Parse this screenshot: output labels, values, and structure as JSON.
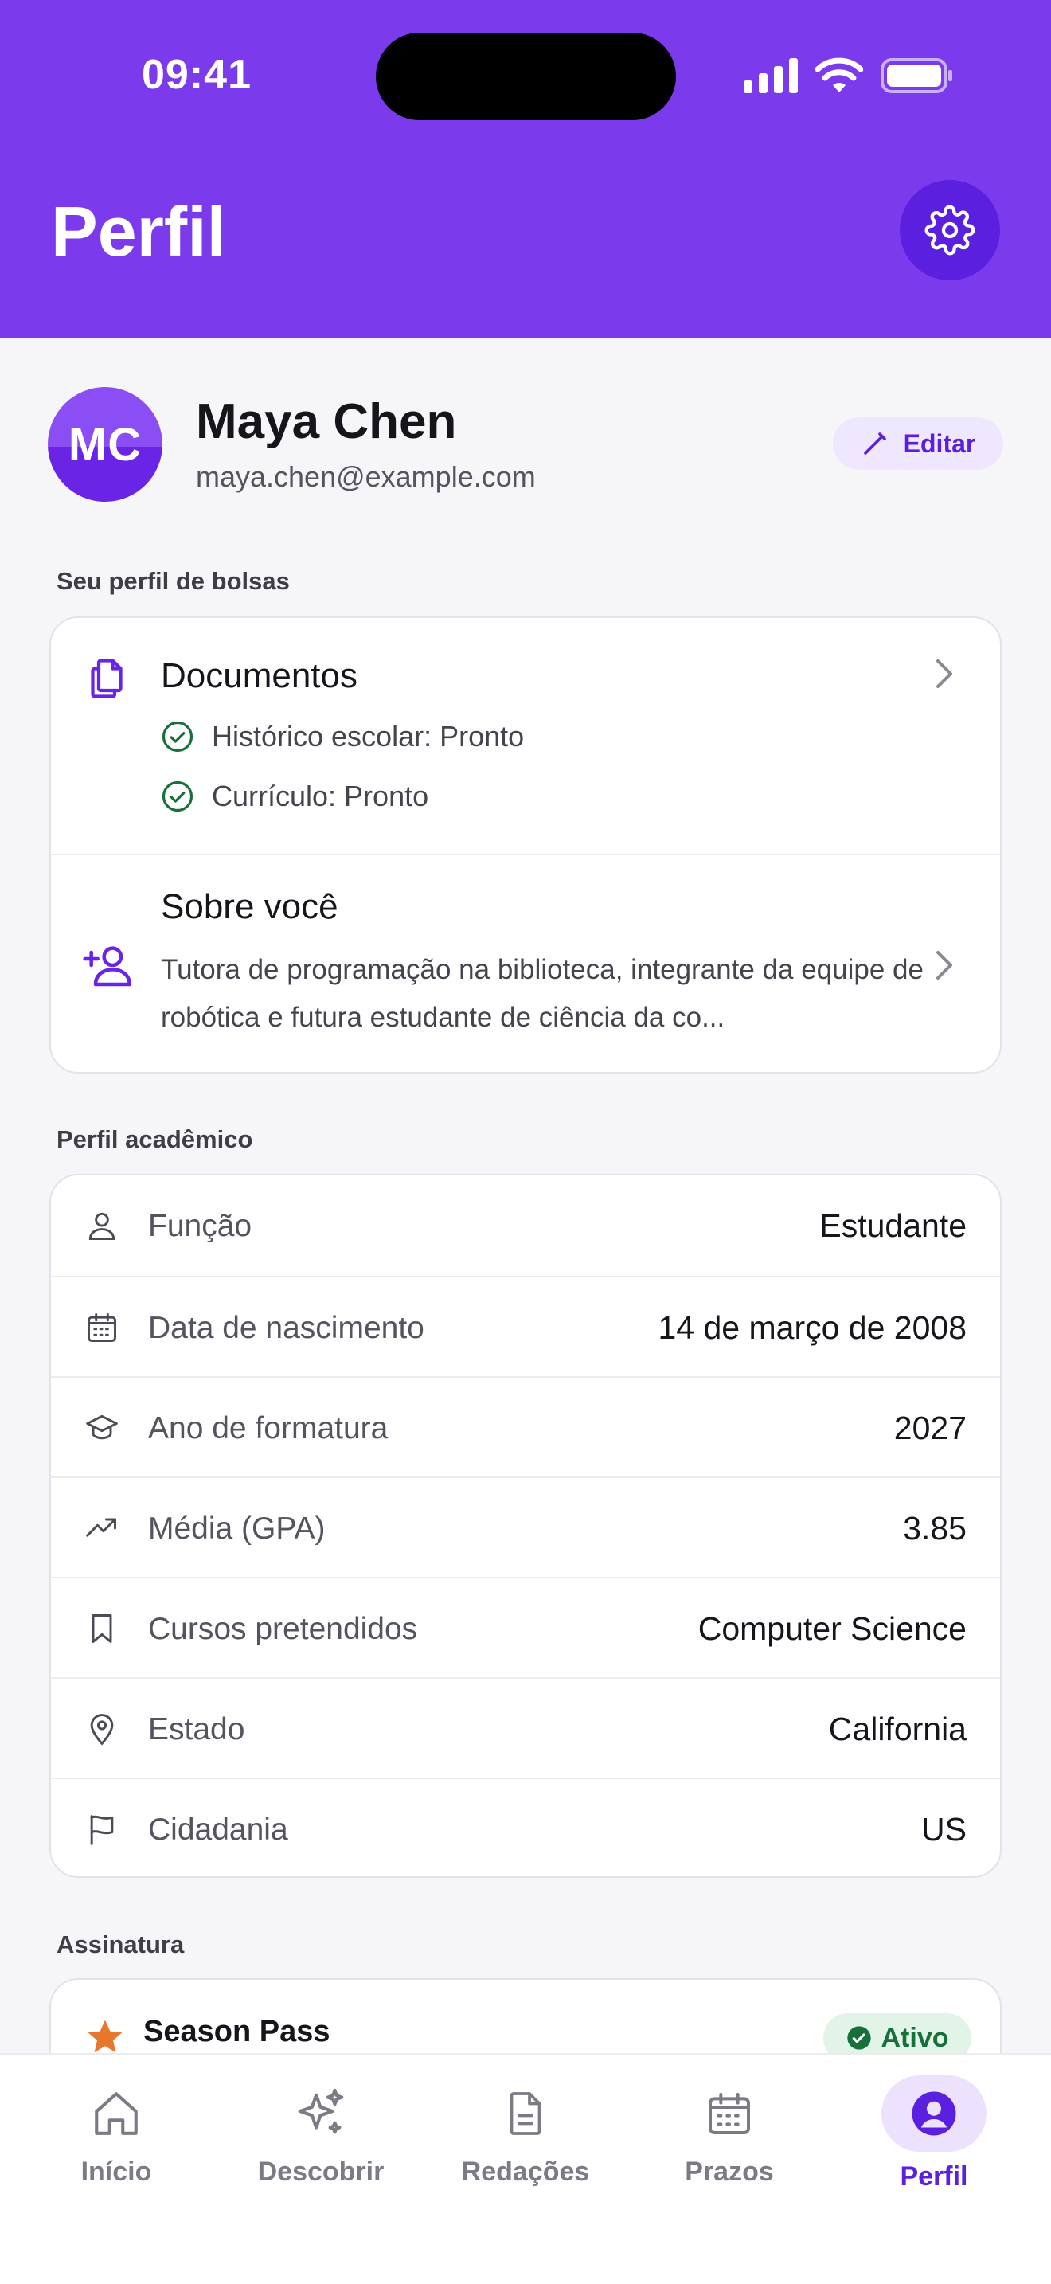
{
  "status_bar": {
    "time": "09:41"
  },
  "header": {
    "title": "Perfil",
    "settings_icon": "gear-icon"
  },
  "colors": {
    "brand": "#7b3aeb",
    "brand_dark": "#5b1fe0",
    "success": "#17703a",
    "star": "#e8772e"
  },
  "profile": {
    "initials": "MC",
    "name": "Maya Chen",
    "email": "maya.chen@example.com",
    "edit_label": "Editar"
  },
  "scholarship_profile": {
    "section_label": "Seu perfil de bolsas",
    "documents": {
      "title": "Documentos",
      "items": [
        "Histórico escolar: Pronto",
        "Currículo: Pronto"
      ]
    },
    "about": {
      "title": "Sobre você",
      "text": "Tutora de programação na biblioteca, integrante da equipe de robótica e futura estudante de ciência da co..."
    }
  },
  "academic_profile": {
    "section_label": "Perfil acadêmico",
    "rows": [
      {
        "icon": "person-icon",
        "label": "Função",
        "value": "Estudante"
      },
      {
        "icon": "calendar-icon",
        "label": "Data de nascimento",
        "value": "14 de março de 2008"
      },
      {
        "icon": "graduation-cap-icon",
        "label": "Ano de formatura",
        "value": "2027"
      },
      {
        "icon": "trending-up-icon",
        "label": "Média (GPA)",
        "value": "3.85"
      },
      {
        "icon": "bookmark-icon",
        "label": "Cursos pretendidos",
        "value": "Computer Science"
      },
      {
        "icon": "location-pin-icon",
        "label": "Estado",
        "value": "California"
      },
      {
        "icon": "flag-icon",
        "label": "Cidadania",
        "value": "US"
      }
    ]
  },
  "subscription": {
    "section_label": "Assinatura",
    "plan_name": "Season Pass",
    "status": "Ativo"
  },
  "tabbar": {
    "tabs": [
      {
        "label": "Início",
        "icon": "home-icon",
        "active": false
      },
      {
        "label": "Descobrir",
        "icon": "sparkles-icon",
        "active": false
      },
      {
        "label": "Redações",
        "icon": "document-icon",
        "active": false
      },
      {
        "label": "Prazos",
        "icon": "calendar-icon",
        "active": false
      },
      {
        "label": "Perfil",
        "icon": "profile-icon",
        "active": true
      }
    ]
  }
}
